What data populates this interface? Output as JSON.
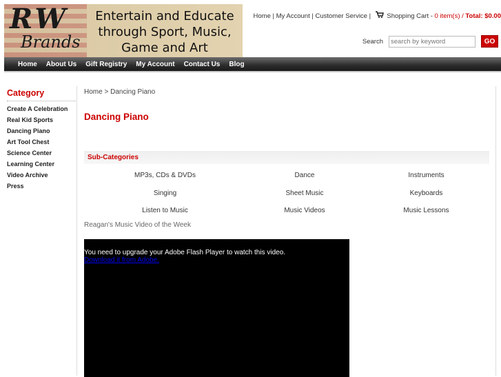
{
  "header": {
    "logo_text": "RW Brands",
    "logo_line1": "RW",
    "logo_line2": "Brands",
    "slogan": "Entertain and Educate through Sport, Music, Game and Art"
  },
  "toplinks": {
    "home": "Home",
    "account": "My Account",
    "service": "Customer Service",
    "cart": "Shopping Cart",
    "sep": " | ",
    "dash": " - ",
    "items": "0 item(s)",
    "slash": " / ",
    "total": "Total: $0.00"
  },
  "search": {
    "label": "Search",
    "placeholder": "search by keyword",
    "button": "GO"
  },
  "nav": [
    "Home",
    "About Us",
    "Gift Registry",
    "My Account",
    "Contact Us",
    "Blog"
  ],
  "sidebar": {
    "title": "Category",
    "items": [
      "Create A Celebration",
      "Real Kid Sports",
      "Dancing Piano",
      "Art Tool Chest",
      "Science Center",
      "Learning Center",
      "Video Archive",
      "Press"
    ]
  },
  "breadcrumb": {
    "home": "Home",
    "sep": " > ",
    "current": "Dancing Piano"
  },
  "page_title": "Dancing Piano",
  "subcategories": {
    "title": "Sub-Categories",
    "items": [
      "MP3s, CDs & DVDs",
      "Dance",
      "Instruments",
      "Singing",
      "Sheet Music",
      "Keyboards",
      "Listen to Music",
      "Music Videos",
      "Music Lessons"
    ]
  },
  "video": {
    "title": "Reagan's Music Video of the Week",
    "message": "You need to upgrade your Adobe Flash Player to watch this video.",
    "link": "Download it from Adobe."
  },
  "colors": {
    "accent": "#cc0000"
  }
}
